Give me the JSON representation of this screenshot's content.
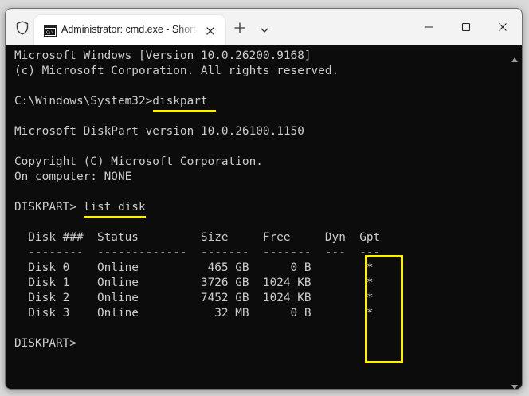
{
  "tab": {
    "title": "Administrator: cmd.exe - Shortcut"
  },
  "console": {
    "lines": [
      "Microsoft Windows [Version 10.0.26200.9168]",
      "(c) Microsoft Corporation. All rights reserved.",
      "",
      "C:\\Windows\\System32>diskpart",
      "",
      "Microsoft DiskPart version 10.0.26100.1150",
      "",
      "Copyright (C) Microsoft Corporation.",
      "On computer: NONE",
      "",
      "DISKPART> list disk",
      "",
      "  Disk ###  Status         Size     Free     Dyn  Gpt",
      "  --------  -------------  -------  -------  ---  ---",
      "  Disk 0    Online          465 GB      0 B        *",
      "  Disk 1    Online         3726 GB  1024 KB        *",
      "  Disk 2    Online         7452 GB  1024 KB        *",
      "  Disk 3    Online           32 MB      0 B        *",
      "",
      "DISKPART>"
    ]
  },
  "colors": {
    "console_background": "#0c0c0c",
    "console_text": "#cccccc",
    "annotation": "#fff200",
    "titlebar": "#f3f3f3"
  },
  "icons": {
    "titlebar": [
      "shield-icon",
      "cmd-icon",
      "close-icon",
      "plus-icon",
      "chevron-down-icon",
      "minimize-icon",
      "maximize-icon",
      "close-window-icon"
    ],
    "scrollbar": [
      "scroll-up-arrow-icon",
      "scroll-down-arrow-icon"
    ]
  }
}
